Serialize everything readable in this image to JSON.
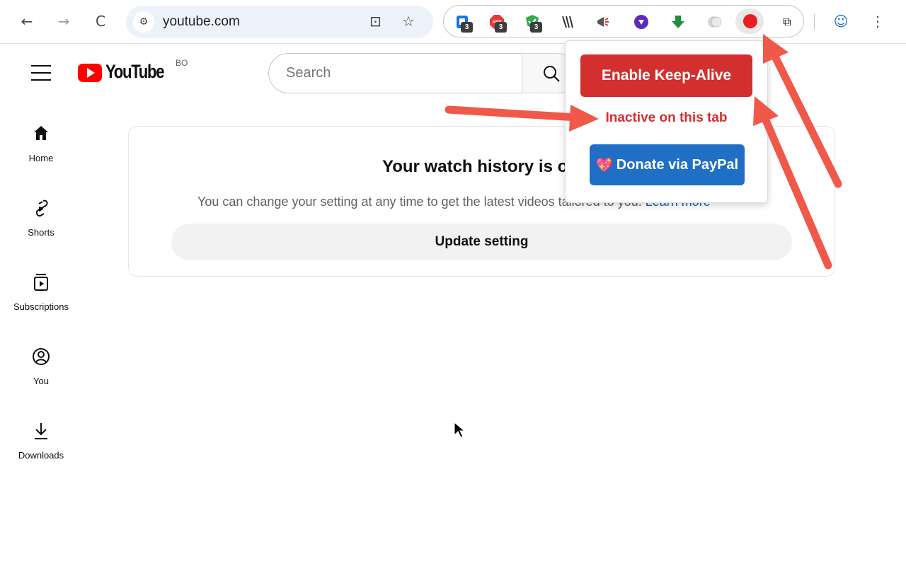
{
  "browser": {
    "back_icon": "←",
    "forward_icon": "→",
    "reload_icon": "C",
    "site_settings_icon": "⚙",
    "url": "youtube.com",
    "install_icon": "⊡",
    "star_icon": "☆",
    "extensions_icon": "⧉",
    "profile_icon": "☺",
    "menu_icon": "⋮",
    "extension_badges": [
      "3",
      "3",
      "3"
    ]
  },
  "youtube": {
    "logo_text": "YouTube",
    "country_code": "BO",
    "search_placeholder": "Search",
    "search_icon": "⚲"
  },
  "sidebar": {
    "items": [
      {
        "label": "Home",
        "icon": "⌂"
      },
      {
        "label": "Shorts",
        "icon": "ʂ"
      },
      {
        "label": "Subscriptions",
        "icon": "▣"
      },
      {
        "label": "You",
        "icon": "◎"
      },
      {
        "label": "Downloads",
        "icon": "⤓"
      }
    ]
  },
  "main": {
    "title": "Your watch history is o",
    "description": "You can change your setting at any time to get the latest videos tailored to you.",
    "link": "Learn more",
    "button": "Update setting"
  },
  "popup": {
    "primary_button": "Enable Keep-Alive",
    "status": "Inactive on this tab",
    "donate_button": "Donate via PayPal",
    "donate_icon": "💖"
  },
  "colors": {
    "popup_red": "#d32f2f",
    "paypal_blue": "#1f6fc4",
    "youtube_red": "#ff0000",
    "annotation_arrow": "#f0584a",
    "link_blue": "#065fd4"
  }
}
